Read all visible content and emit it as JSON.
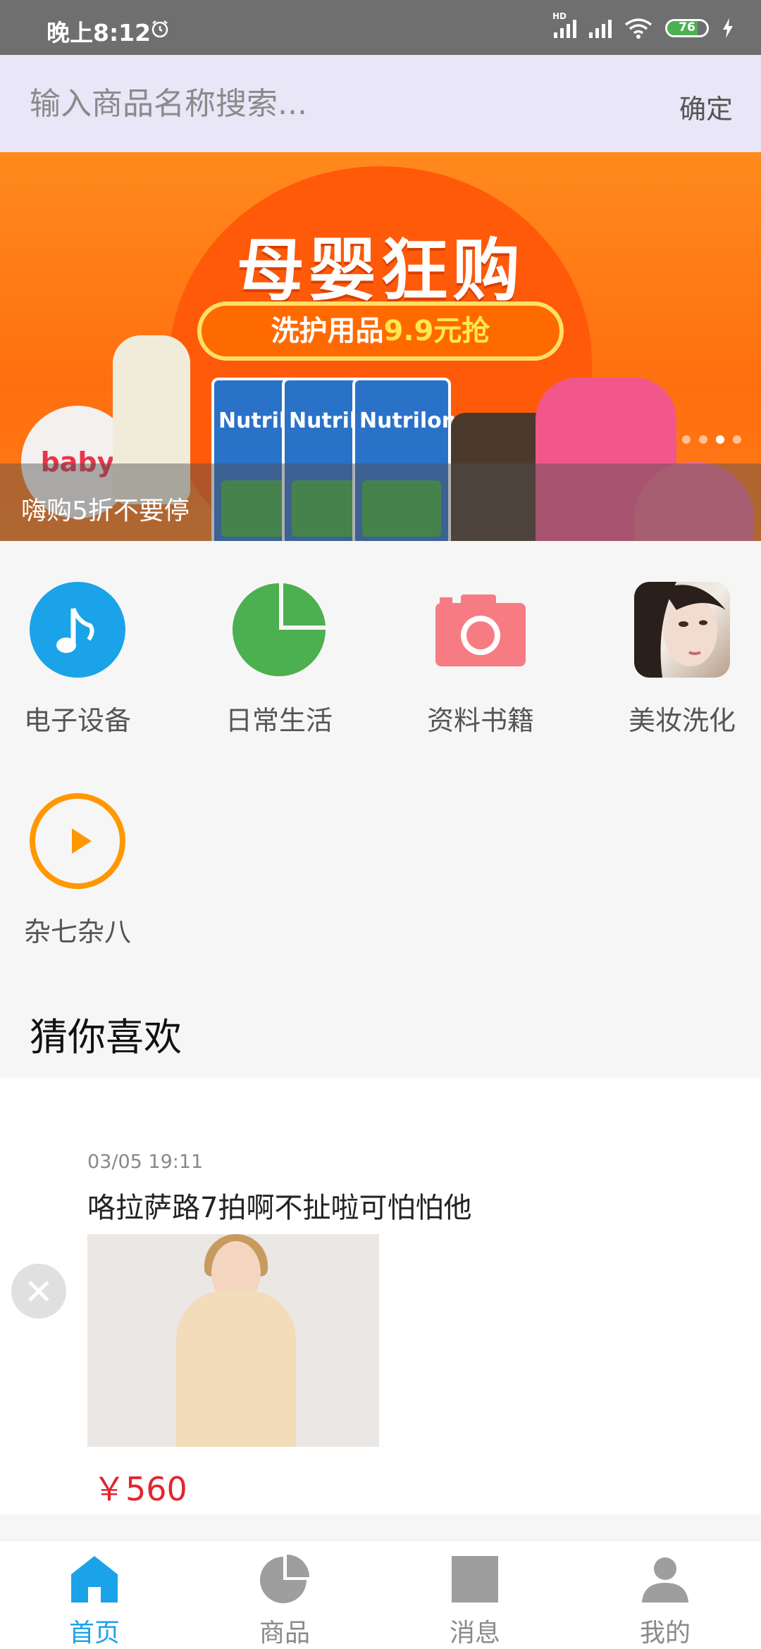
{
  "status_bar": {
    "time": "晚上8:12",
    "battery": "76",
    "battery_level": 0.76
  },
  "search": {
    "placeholder": "输入商品名称搜索...",
    "confirm_label": "确定"
  },
  "banner": {
    "title": "母婴狂购",
    "subtitle_prefix": "洗护用品",
    "subtitle_highlight": "9.9元抢",
    "caption": "嗨购5折不要停",
    "can_brand": "Nutrilon",
    "bottle_brand": "baby",
    "dots_total": 4,
    "dots_active": 3
  },
  "categories": [
    {
      "label": "电子设备",
      "icon": "music-icon",
      "color": "#1aa3e8"
    },
    {
      "label": "日常生活",
      "icon": "pie-chart-icon",
      "color": "#4caf50"
    },
    {
      "label": "资料书籍",
      "icon": "camera-icon",
      "color": "#f77b82"
    },
    {
      "label": "美妆洗化",
      "icon": "avatar-photo"
    },
    {
      "label": "杂七杂八",
      "icon": "play-icon",
      "color": "#ff9800"
    }
  ],
  "section_title": "猜你喜欢",
  "feed_item": {
    "time": "03/05 19:11",
    "title": "咯拉萨路7拍啊不扯啦可怕怕他",
    "price": "￥560"
  },
  "tabs": [
    {
      "label": "首页",
      "icon": "home-icon",
      "active": true
    },
    {
      "label": "商品",
      "icon": "pie-chart-icon",
      "active": false
    },
    {
      "label": "消息",
      "icon": "message-icon",
      "active": false
    },
    {
      "label": "我的",
      "icon": "user-icon",
      "active": false
    }
  ],
  "colors": {
    "accent": "#1aa3e8",
    "price": "#e3252d",
    "search_bg": "#e8e6f7",
    "banner_orange": "#ff7a1a"
  }
}
